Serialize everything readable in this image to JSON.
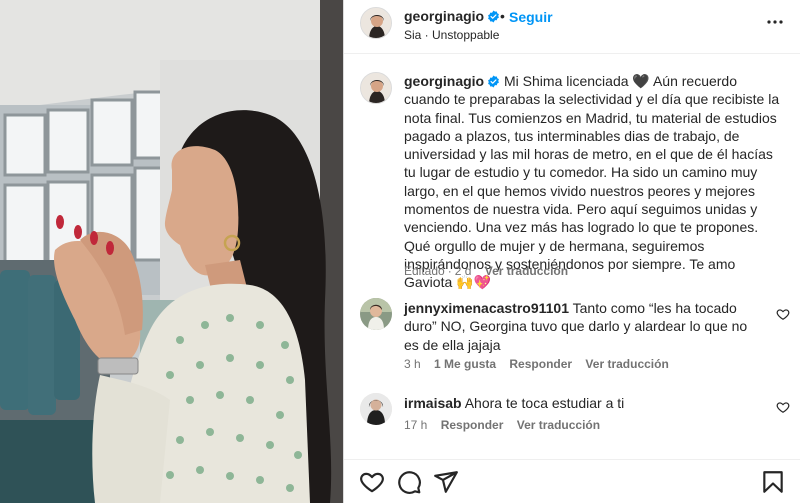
{
  "post": {
    "username": "georginagio",
    "verified": true,
    "follow_label": "Seguir",
    "separator": "•",
    "audio": "Sia · Unstoppable"
  },
  "caption": {
    "username": "georginagio",
    "text": "Mi Shima licenciada 🖤 Aún recuerdo cuando te preparabas la selectividad y el día que recibiste la nota final. Tus comienzos en Madrid, tu material de estudios pagado a plazos, tus interminables dias de trabajo, de universidad y las mil horas de metro, en el que de él hacías tu lugar de estudio y tu comedor. Ha sido un camino muy largo, en el que hemos vivido nuestros peores y mejores momentos de nuestra vida. Pero aquí seguimos unidas y venciendo. Una vez más has logrado lo que te propones. Qué orgullo de mujer y de hermana, seguiremos inspirándonos y sosteniéndonos por siempre. Te amo Gaviota 🙌💖",
    "edited": "Editado",
    "time": "2 d",
    "translate": "Ver traducción"
  },
  "comments": [
    {
      "username": "jennyximenacastro91101",
      "text": "Tanto como “les ha tocado duro” NO, Georgina tuvo que darlo y alardear lo que no es de ella jajaja",
      "time": "3 h",
      "likes": "1 Me gusta",
      "reply": "Responder",
      "translate": "Ver traducción"
    },
    {
      "username": "irmaisab",
      "text": "Ahora te toca estudiar a ti",
      "time": "17 h",
      "reply": "Responder",
      "translate": "Ver traducción"
    }
  ],
  "icons": {
    "more": "more-options-icon",
    "like": "heart-icon",
    "comment": "comment-icon",
    "share": "share-icon",
    "save": "bookmark-icon"
  },
  "colors": {
    "link": "#0095f6",
    "text": "#262626",
    "muted": "#737373",
    "verified": "#0095f6"
  }
}
